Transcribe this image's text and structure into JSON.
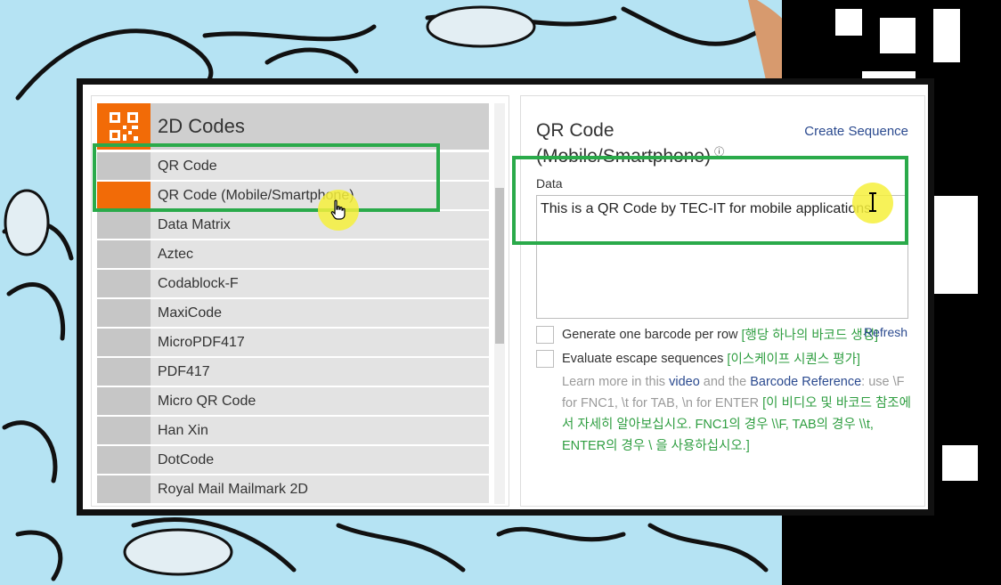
{
  "left_panel": {
    "category_title": "2D Codes",
    "category_icon": "qr-icon",
    "items": [
      {
        "label": "QR Code",
        "active": false
      },
      {
        "label": "QR Code (Mobile/Smartphone)",
        "active": true
      },
      {
        "label": "Data Matrix",
        "active": false
      },
      {
        "label": "Aztec",
        "active": false
      },
      {
        "label": "Codablock-F",
        "active": false
      },
      {
        "label": "MaxiCode",
        "active": false
      },
      {
        "label": "MicroPDF417",
        "active": false
      },
      {
        "label": "PDF417",
        "active": false
      },
      {
        "label": "Micro QR Code",
        "active": false
      },
      {
        "label": "Han Xin",
        "active": false
      },
      {
        "label": "DotCode",
        "active": false
      },
      {
        "label": "Royal Mail Mailmark 2D",
        "active": false
      }
    ]
  },
  "right_panel": {
    "title": "QR Code (Mobile/Smartphone)",
    "info_icon": "info-icon",
    "create_sequence": "Create Sequence",
    "data_label": "Data",
    "data_value": "This is a QR Code by TEC-IT for mobile applications",
    "options": [
      {
        "label": "Generate one barcode per row",
        "ko": "[행당 하나의 바코드 생성]"
      },
      {
        "label": "Evaluate escape sequences",
        "ko": "[이스케이프 시퀀스 평가]"
      }
    ],
    "refresh": "Refresh",
    "help": {
      "learn_more": "Learn more in this",
      "video": "video",
      "and_the": "and the",
      "barcode_reference": "Barcode Reference",
      "use_text": ": use \\F for FNC1, \\t for TAB, \\n for ENTER",
      "ko": "[이 비디오 및 바코드 참조에서 자세히 알아보십시오. FNC1의 경우 \\\\F, TAB의 경우 \\\\t, ENTER의 경우 \\ 을 사용하십시오.]"
    }
  },
  "colors": {
    "accent_orange": "#f26b07",
    "highlight_green": "#2aaa4a",
    "link_blue": "#2b4a8f",
    "korean_green": "#2f9e41",
    "background": "#b5e3f3"
  }
}
